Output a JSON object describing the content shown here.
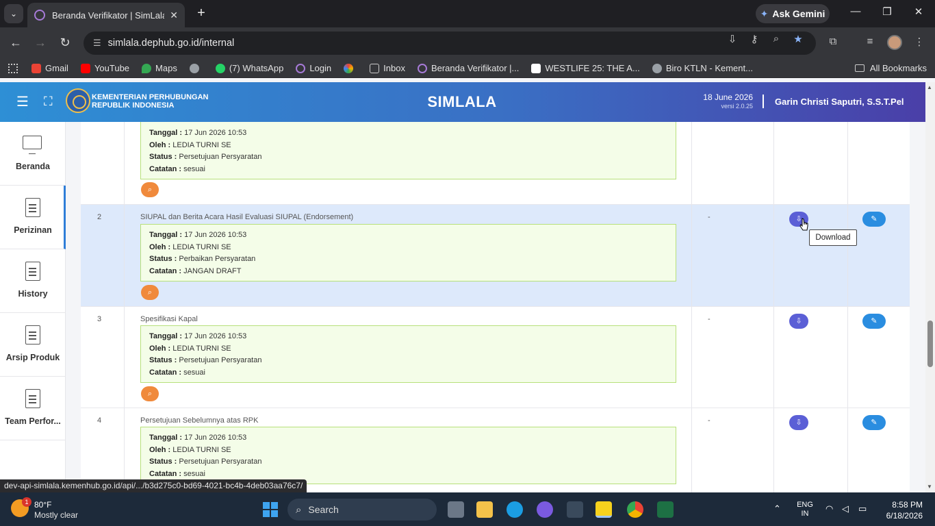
{
  "browser": {
    "tab_title": "Beranda Verifikator | SimLala",
    "tab_close": "✕",
    "new_tab": "+",
    "ask_gemini": "Ask Gemini",
    "url": "simlala.dephub.go.id/internal",
    "bookmarks": [
      {
        "label": "Gmail",
        "color": "#ea4335"
      },
      {
        "label": "YouTube",
        "color": "#ff0000"
      },
      {
        "label": "Maps",
        "color": "#34a853"
      },
      {
        "label": "",
        "color": "#9aa0a6"
      },
      {
        "label": "(7) WhatsApp",
        "color": "#25d366"
      },
      {
        "label": "Login",
        "color": "#a77bd8"
      },
      {
        "label": "",
        "color": "#f4b400"
      },
      {
        "label": "Inbox",
        "color": "#9aa0a6"
      },
      {
        "label": "Beranda Verifikator |...",
        "color": "#a77bd8"
      },
      {
        "label": "WESTLIFE 25: THE A...",
        "color": "#ffffff"
      },
      {
        "label": "Biro KTLN - Kement...",
        "color": "#9aa0a6"
      }
    ],
    "all_bookmarks": "All Bookmarks",
    "status_url": "dev-api-simlala.kemenhub.go.id/api/.../b3d275c0-bd69-4021-bc4b-4deb03aa76c7/"
  },
  "header": {
    "ministry_line1": "KEMENTERIAN PERHUBUNGAN",
    "ministry_line2": "REPUBLIK INDONESIA",
    "app_name": "SIMLALA",
    "date": "18 June 2026",
    "version": "versi 2.0.25",
    "user": "Garin Christi Saputri, S.S.T.Pel"
  },
  "sidebar": {
    "items": [
      {
        "label": "Beranda"
      },
      {
        "label": "Perizinan"
      },
      {
        "label": "History"
      },
      {
        "label": "Arsip Produk"
      },
      {
        "label": "Team Perfor..."
      }
    ]
  },
  "labels": {
    "tanggal": "Tanggal :",
    "oleh": "Oleh :",
    "status": "Status :",
    "catatan": "Catatan :"
  },
  "rows": [
    {
      "num": "",
      "name": "",
      "tanggal": "17 Jun 2026 10:53",
      "oleh": "LEDIA TURNI SE",
      "status": "Persetujuan Persyaratan",
      "catatan": "sesuai",
      "dash": ""
    },
    {
      "num": "2",
      "name": "SIUPAL dan Berita Acara Hasil Evaluasi SIUPAL (Endorsement)",
      "tanggal": "17 Jun 2026 10:53",
      "oleh": "LEDIA TURNI SE",
      "status": "Perbaikan Persyaratan",
      "catatan": "JANGAN DRAFT",
      "dash": "-"
    },
    {
      "num": "3",
      "name": "Spesifikasi Kapal",
      "tanggal": "17 Jun 2026 10:53",
      "oleh": "LEDIA TURNI SE",
      "status": "Persetujuan Persyaratan",
      "catatan": "sesuai",
      "dash": "-"
    },
    {
      "num": "4",
      "name": "Persetujuan Sebelumnya atas RPK",
      "tanggal": "17 Jun 2026 10:53",
      "oleh": "LEDIA TURNI SE",
      "status": "Persetujuan Persyaratan",
      "catatan": "sesuai",
      "dash": "-"
    }
  ],
  "tooltip": "Download",
  "taskbar": {
    "temp": "80°F",
    "condition": "Mostly clear",
    "weather_badge": "1",
    "search_label": "Search",
    "lang_line1": "ENG",
    "lang_line2": "IN",
    "time": "8:58 PM",
    "date": "6/18/2026"
  }
}
